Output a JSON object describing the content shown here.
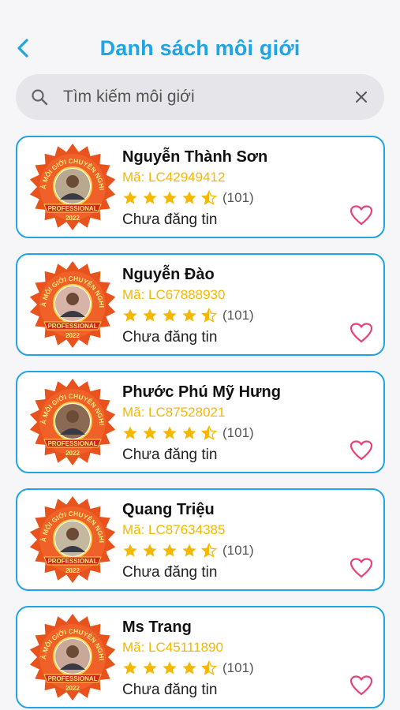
{
  "header": {
    "title": "Danh sách môi giới",
    "back_icon": "chevron-left-icon"
  },
  "search": {
    "placeholder": "Tìm kiếm môi giới",
    "value": "",
    "search_icon": "search-icon",
    "clear_icon": "close-icon"
  },
  "colors": {
    "accent": "#1fa4e6",
    "code": "#f5b800",
    "star": "#f5b800",
    "heart": "#e8407a",
    "badge_fill": "#e8521c",
    "badge_text": "#ffe97a"
  },
  "badge_text": {
    "arc": "NHÀ MÔI GIỚI CHUYÊN NGHIỆP",
    "ribbon": "PROFESSIONAL",
    "year": "2022"
  },
  "brokers": [
    {
      "name": "Nguyễn Thành Sơn",
      "code": "Mã: LC42949412",
      "rating": 4.5,
      "reviews": "(101)",
      "status": "Chưa đăng tin"
    },
    {
      "name": "Nguyễn Đào",
      "code": "Mã: LC67888930",
      "rating": 4.5,
      "reviews": "(101)",
      "status": "Chưa đăng tin"
    },
    {
      "name": "Phước Phú Mỹ Hưng",
      "code": "Mã: LC87528021",
      "rating": 4.5,
      "reviews": "(101)",
      "status": "Chưa đăng tin"
    },
    {
      "name": "Quang Triệu",
      "code": "Mã: LC87634385",
      "rating": 4.5,
      "reviews": "(101)",
      "status": "Chưa đăng tin"
    },
    {
      "name": "Ms Trang",
      "code": "Mã: LC45111890",
      "rating": 4.5,
      "reviews": "(101)",
      "status": "Chưa đăng tin"
    }
  ]
}
